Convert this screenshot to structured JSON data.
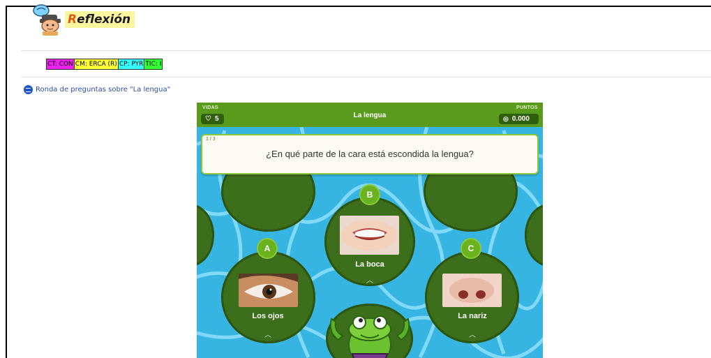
{
  "header": {
    "title_first_letter": "R",
    "title_rest": "eflexión"
  },
  "tags": [
    {
      "text": "CT: CON",
      "color": "#ee22ee"
    },
    {
      "text": "CM: ERCA (R)",
      "color": "#ffff33"
    },
    {
      "text": "CP: PYR",
      "color": "#33ffff"
    },
    {
      "text": "TIC: I",
      "color": "#33ff33"
    }
  ],
  "activity_link": {
    "text": "Ronda de preguntas sobre \"La lengua\""
  },
  "game": {
    "title": "La lengua",
    "lives_label": "VIDAS",
    "lives_value": "5",
    "points_label": "PUNTOS",
    "points_value": "0.000",
    "question_counter": "1 / 3",
    "question": "¿En qué parte de la cara está escondida la lengua?",
    "options": [
      {
        "letter": "A",
        "label": "Los ojos"
      },
      {
        "letter": "B",
        "label": "La boca"
      },
      {
        "letter": "C",
        "label": "La nariz"
      }
    ]
  }
}
